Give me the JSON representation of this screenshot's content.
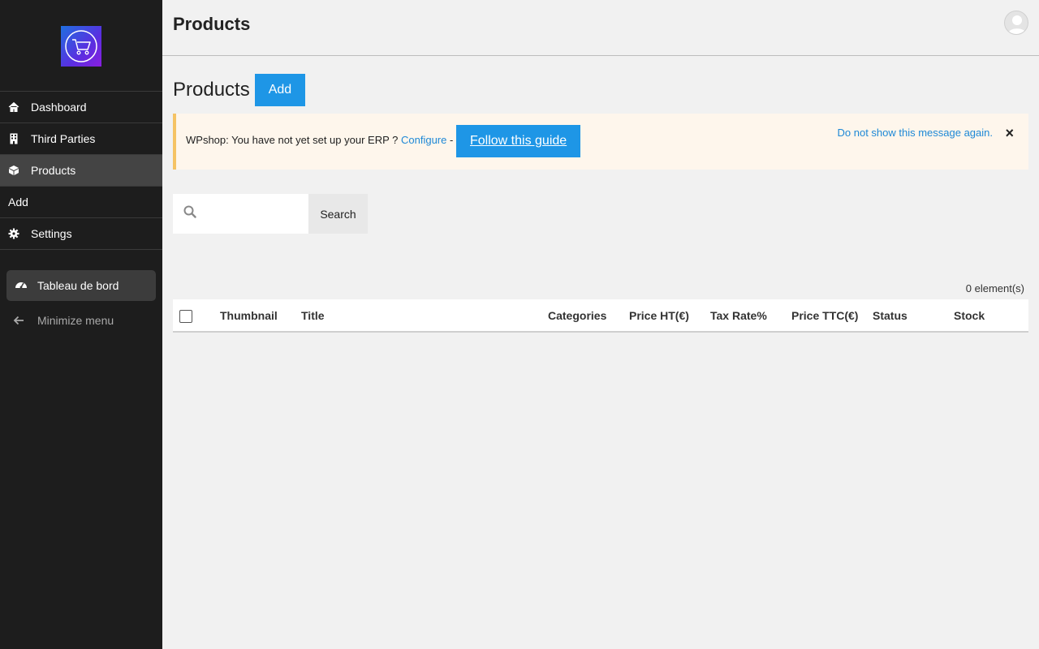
{
  "sidebar": {
    "logo": "shopping-cart-icon",
    "items": [
      {
        "label": "Dashboard",
        "icon": "home-icon"
      },
      {
        "label": "Third Parties",
        "icon": "building-icon"
      },
      {
        "label": "Products",
        "icon": "box-icon",
        "active": true
      },
      {
        "label": "Add"
      },
      {
        "label": "Settings",
        "icon": "gear-icon"
      }
    ],
    "dashboard_button": "Tableau de bord",
    "minimize_label": "Minimize menu"
  },
  "header": {
    "title": "Products"
  },
  "page": {
    "heading": "Products",
    "add_label": "Add"
  },
  "notice": {
    "text": "WPshop: You have not yet set up your ERP ? ",
    "configure_link": "Configure",
    "separator": " - ",
    "guide_button": "Follow this guide",
    "dismiss_link": "Do not show this message again.",
    "close_icon": "×"
  },
  "search": {
    "placeholder": "",
    "button_label": "Search"
  },
  "table": {
    "count": "0 element(s)",
    "columns": [
      "Thumbnail",
      "Title",
      "Categories",
      "Price HT(€)",
      "Tax Rate%",
      "Price TTC(€)",
      "Status",
      "Stock"
    ]
  },
  "colors": {
    "sidebar_bg": "#1d1d1d",
    "accent": "#1e96e6",
    "notice_border": "#f5c364",
    "link": "#1e88d6"
  }
}
